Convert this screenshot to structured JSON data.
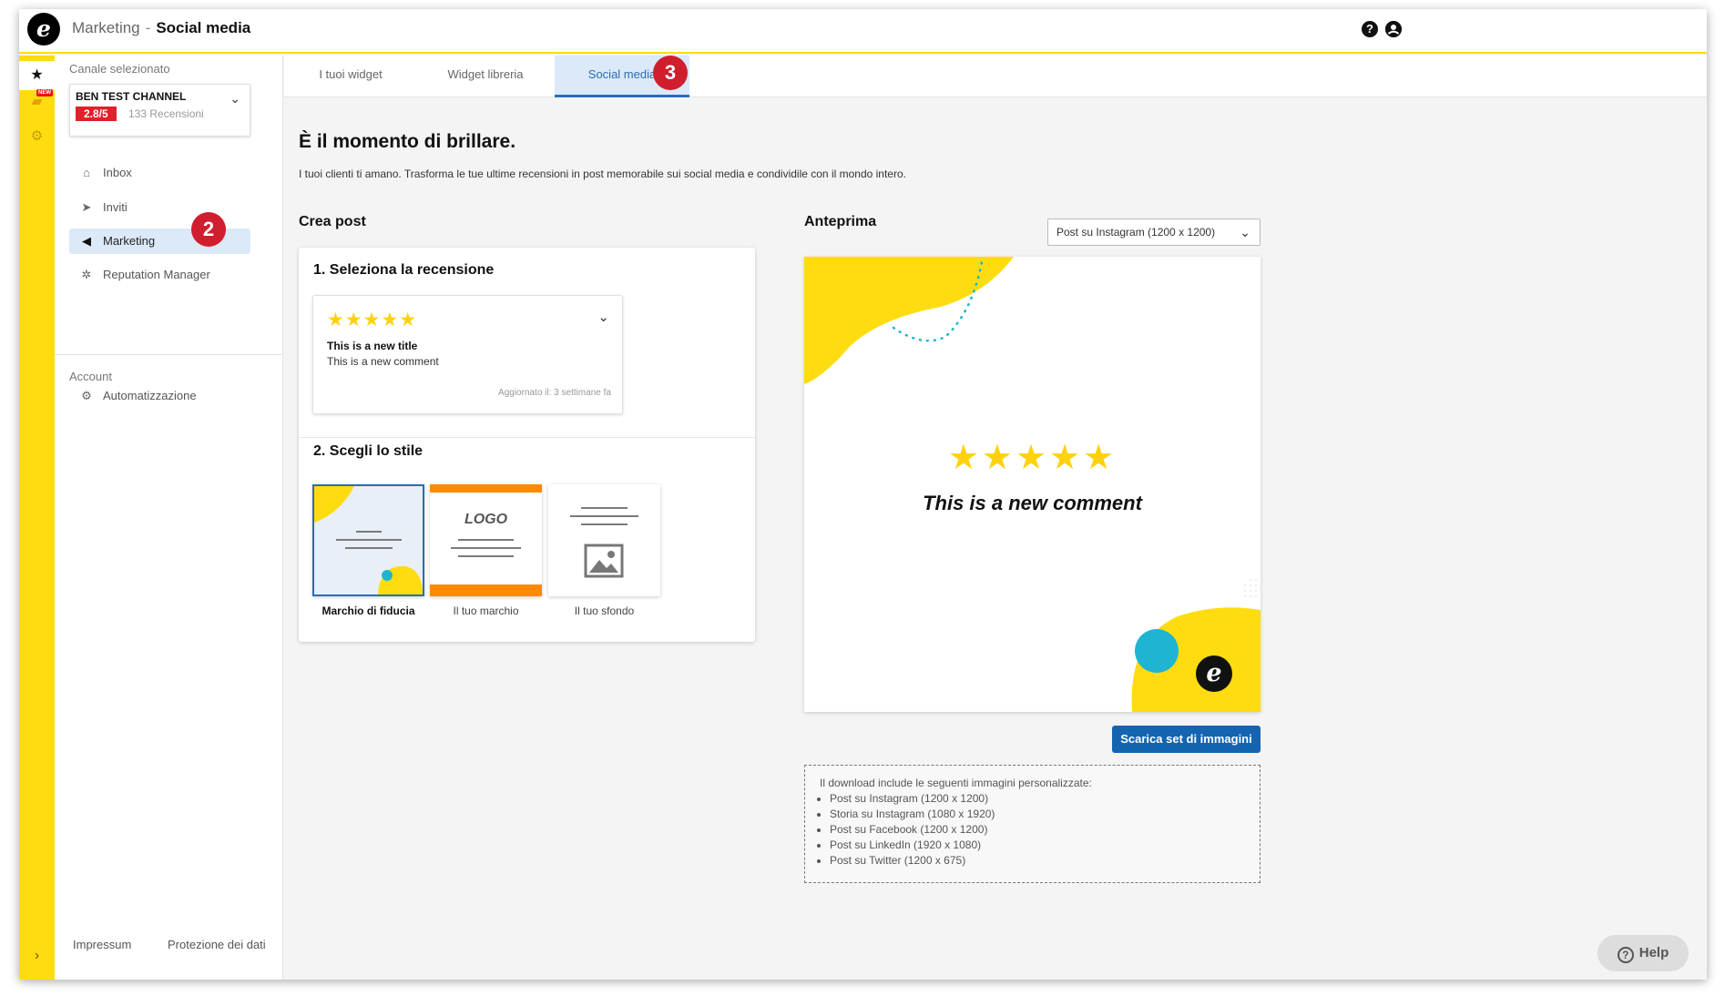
{
  "header": {
    "breadcrumb_parent": "Marketing",
    "breadcrumb_separator": "-",
    "breadcrumb_current": "Social media",
    "help_icon": "?",
    "user_icon": "person-icon"
  },
  "rail": {
    "items": [
      "star-icon",
      "new-feature-icon",
      "gear-icon"
    ],
    "new_badge": "NEW",
    "expand_icon": "›"
  },
  "sidebar": {
    "channel_caption": "Canale selezionato",
    "channel_name": "BEN TEST CHANNEL",
    "channel_score": "2.8/5",
    "channel_reviews": "133 Recensioni",
    "nav": [
      {
        "label": "Inbox",
        "icon": "inbox-icon"
      },
      {
        "label": "Inviti",
        "icon": "send-icon"
      },
      {
        "label": "Marketing",
        "icon": "megaphone-icon"
      },
      {
        "label": "Reputation Manager",
        "icon": "sparkle-icon"
      }
    ],
    "account_caption": "Account",
    "account_nav": [
      {
        "label": "Automatizzazione",
        "icon": "automation-icon"
      }
    ],
    "footer_links": [
      "Impressum",
      "Protezione dei dati"
    ]
  },
  "step_badges": {
    "marketing": "2",
    "social_tab": "3"
  },
  "tabs": [
    {
      "label": "I tuoi widget"
    },
    {
      "label": "Widget libreria"
    },
    {
      "label": "Social media"
    }
  ],
  "main": {
    "headline": "È il momento di brillare.",
    "subline": "I tuoi clienti ti amano. Trasforma le tue ultime recensioni in post memorabile sui social media e condividile con il mondo intero.",
    "create_title": "Crea post",
    "preview_title": "Anteprima"
  },
  "create": {
    "step1_title": "1. Seleziona la recensione",
    "review": {
      "stars": "★★★★★",
      "title": "This is a new title",
      "comment": "This is a new comment",
      "updated": "Aggiornato il: 3 settimane fa"
    },
    "step2_title": "2. Scegli lo stile",
    "styles": [
      {
        "label": "Marchio di fiducia"
      },
      {
        "label": "Il tuo marchio",
        "logo_text": "LOGO"
      },
      {
        "label": "Il tuo sfondo"
      }
    ]
  },
  "preview": {
    "format_selected": "Post su Instagram (1200 x 1200)",
    "stars": "★★★★★",
    "comment": "This is a new comment",
    "logo_letter": "e"
  },
  "download": {
    "button": "Scarica set di immagini",
    "info_title": "Il download include le seguenti immagini personalizzate:",
    "items": [
      "Post su Instagram (1200 x 1200)",
      "Storia su Instagram (1080 x 1920)",
      "Post su Facebook (1200 x 1200)",
      "Post su LinkedIn (1920 x 1080)",
      "Post su Twitter (1200 x 675)"
    ]
  },
  "help": {
    "label": "Help",
    "icon": "?"
  },
  "colors": {
    "accent_yellow": "#ffdc0f",
    "primary_blue": "#1464b0",
    "badge_red": "#d01e2e",
    "cyan": "#1eb4d2"
  }
}
